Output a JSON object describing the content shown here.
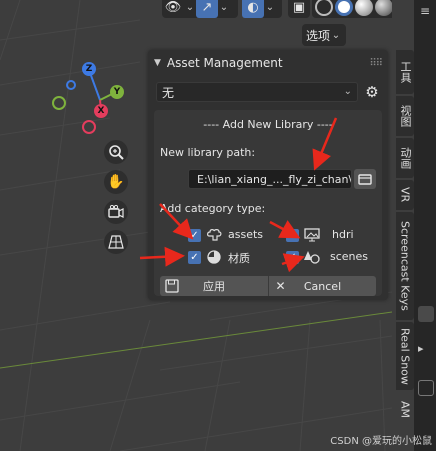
{
  "header": {
    "options_label": "选项"
  },
  "gizmo": {
    "z": "Z",
    "y": "Y",
    "x": "X"
  },
  "panel": {
    "title": "Asset Management",
    "library_selected": "无",
    "section_title": "---- Add New Library ----",
    "path_label": "New library path:",
    "path_value": "E:\\lian_xiang_..._fly_zi_chan\\",
    "category_label": "Add category type:",
    "categories": [
      {
        "label": "assets",
        "checked": true,
        "icon": "brain-icon"
      },
      {
        "label": "hdri",
        "checked": true,
        "icon": "monitor-icon"
      },
      {
        "label": "材质",
        "checked": true,
        "icon": "material-sphere-icon"
      },
      {
        "label": "scenes",
        "checked": true,
        "icon": "scene-shapes-icon"
      }
    ],
    "apply_label": "应用",
    "cancel_label": "Cancel"
  },
  "tabs": [
    "工具",
    "视图",
    "动画",
    "VR",
    "Screencast Keys",
    "Real Snow",
    "AM"
  ],
  "footer": "CSDN @爱玩的小松鼠",
  "colors": {
    "accent": "#4772b3",
    "viewport_bg": "#3d3d3d",
    "x_axis": "#e43d5d",
    "y_axis": "#7fb33d",
    "z_axis": "#3d7ae4",
    "annotation": "#e8281c"
  }
}
